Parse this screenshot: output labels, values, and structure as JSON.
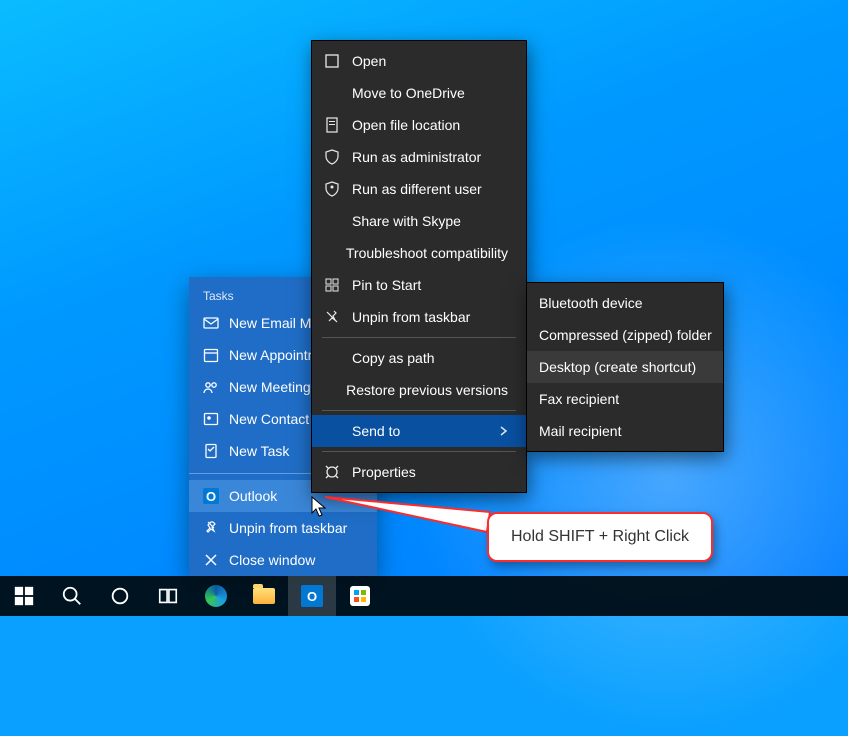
{
  "jumplist": {
    "tasks_header": "Tasks",
    "tasks": [
      {
        "label": "New Email Message"
      },
      {
        "label": "New Appointment"
      },
      {
        "label": "New Meeting"
      },
      {
        "label": "New Contact"
      },
      {
        "label": "New Task"
      }
    ],
    "app_label": "Outlook",
    "unpin_label": "Unpin from taskbar",
    "close_label": "Close window"
  },
  "contextmenu": {
    "items": [
      {
        "label": "Open",
        "icon": "open"
      },
      {
        "label": "Move to OneDrive"
      },
      {
        "label": "Open file location",
        "icon": "location"
      },
      {
        "label": "Run as administrator",
        "icon": "shield"
      },
      {
        "label": "Run as different user",
        "icon": "user"
      },
      {
        "label": "Share with Skype"
      },
      {
        "label": "Troubleshoot compatibility"
      },
      {
        "label": "Pin to Start",
        "icon": "pin"
      },
      {
        "label": "Unpin from taskbar",
        "icon": "unpin"
      },
      {
        "sep": true
      },
      {
        "label": "Copy as path"
      },
      {
        "label": "Restore previous versions"
      },
      {
        "sep": true
      },
      {
        "label": "Send to",
        "submenu": true,
        "highlight": true
      },
      {
        "sep": true
      },
      {
        "label": "Properties",
        "icon": "properties"
      }
    ]
  },
  "sendto_submenu": {
    "items": [
      {
        "label": "Bluetooth device"
      },
      {
        "label": "Compressed (zipped) folder"
      },
      {
        "label": "Desktop (create shortcut)",
        "hover": true
      },
      {
        "label": "Fax recipient"
      },
      {
        "label": "Mail recipient"
      }
    ]
  },
  "callout": {
    "text": "Hold SHIFT + Right Click"
  }
}
